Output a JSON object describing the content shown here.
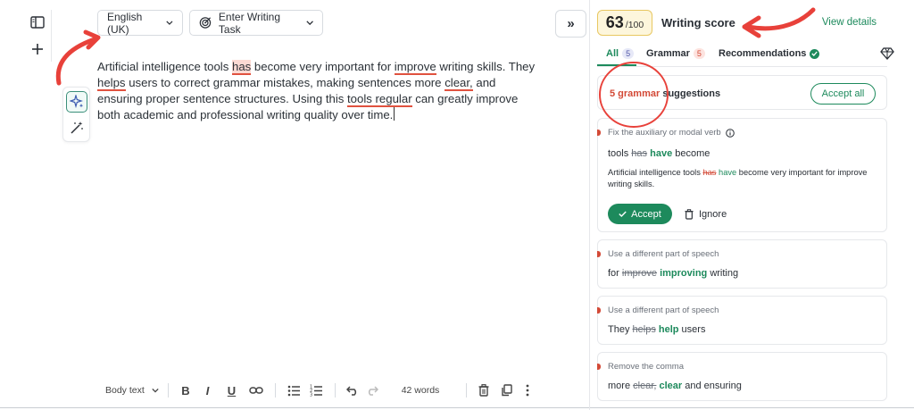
{
  "colors": {
    "accent_green": "#1d8a5c",
    "error_red": "#e0523f",
    "score_bg": "#fdf6dc",
    "annotation_red": "#e8413a"
  },
  "left_rail": {
    "panel_icon": "sidebar-panel-icon",
    "add_icon": "plus-icon"
  },
  "floating_tools": {
    "sparkle_icon": "ai-sparkle-icon",
    "wand_icon": "magic-wand-icon"
  },
  "top_bar": {
    "language_label": "English (UK)",
    "task_label": "Enter Writing Task"
  },
  "editor": {
    "segments": [
      {
        "text": "Artificial intelligence tools ",
        "type": "plain"
      },
      {
        "text": "has",
        "type": "highlight"
      },
      {
        "text": " become very important for ",
        "type": "plain"
      },
      {
        "text": "improve",
        "type": "error"
      },
      {
        "text": " writing skills. They ",
        "type": "plain"
      },
      {
        "text": "helps",
        "type": "error"
      },
      {
        "text": " users to correct grammar mistakes, making sentences more ",
        "type": "plain"
      },
      {
        "text": "clear,",
        "type": "error"
      },
      {
        "text": " and ensuring proper sentence structures. Using this ",
        "type": "plain"
      },
      {
        "text": "tools regular",
        "type": "error"
      },
      {
        "text": " can greatly improve both academic and professional writing quality over time.",
        "type": "plain"
      }
    ]
  },
  "toolbar": {
    "style_label": "Body text",
    "bold_label": "B",
    "italic_label": "I",
    "underline_label": "U",
    "word_count": "42 words"
  },
  "panel": {
    "collapse_label": "»",
    "score_value": "63",
    "score_max": "/100",
    "score_label": "Writing score",
    "view_details": "View details",
    "tabs": [
      {
        "label": "All",
        "count": "5"
      },
      {
        "label": "Grammar",
        "count": "5"
      },
      {
        "label": "Recommendations",
        "count": ""
      }
    ],
    "summary": {
      "count_text": "5 grammar",
      "rest_text": " suggestions",
      "accept_all": "Accept all"
    },
    "cards": [
      {
        "title": "Fix the auxiliary or modal verb",
        "before": "tools ",
        "removed": "has",
        "inserted": "have",
        "after": " become",
        "context_before": "Artificial intelligence tools ",
        "context_removed": "has",
        "context_inserted": "have",
        "context_after": " become very important for improve writing skills.",
        "accept": "Accept",
        "ignore": "Ignore"
      },
      {
        "title": "Use a different part of speech",
        "before": "for ",
        "removed": "improve",
        "inserted": "improving",
        "after": " writing"
      },
      {
        "title": "Use a different part of speech",
        "before": "They ",
        "removed": "helps",
        "inserted": "help",
        "after": " users"
      },
      {
        "title": "Remove the comma",
        "before": "more ",
        "removed": "clear,",
        "inserted": "clear",
        "after": " and ensuring"
      }
    ]
  }
}
